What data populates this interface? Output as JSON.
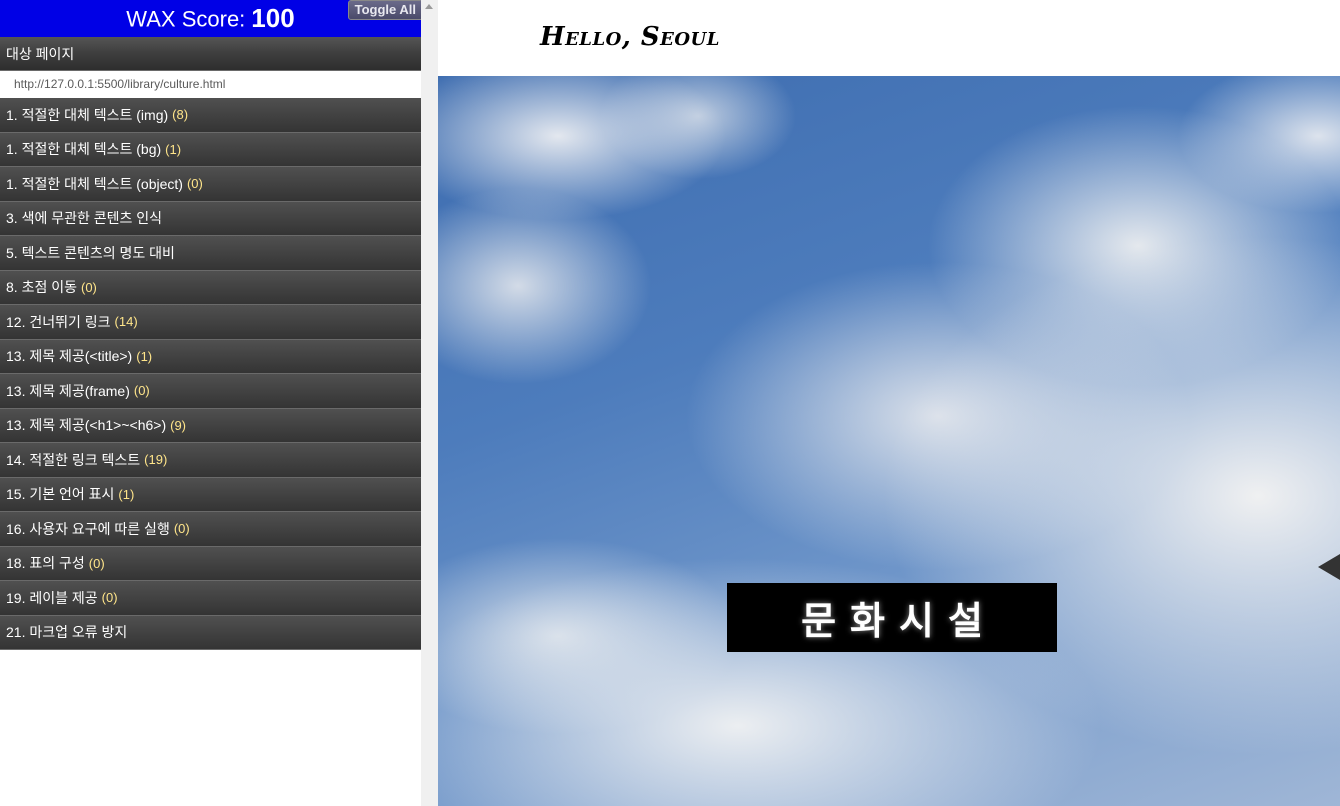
{
  "wax_panel": {
    "score_label": "WAX Score:",
    "score_value": "100",
    "toggle_all_label": "Toggle All",
    "target_page_label": "대상 페이지",
    "target_url": "http://127.0.0.1:5500/library/culture.html",
    "items": [
      {
        "label": "1. 적절한 대체 텍스트 (img)",
        "count": "(8)"
      },
      {
        "label": "1. 적절한 대체 텍스트 (bg)",
        "count": "(1)"
      },
      {
        "label": "1. 적절한 대체 텍스트 (object)",
        "count": "(0)"
      },
      {
        "label": "3. 색에 무관한 콘텐츠 인식",
        "count": ""
      },
      {
        "label": "5. 텍스트 콘텐츠의 명도 대비",
        "count": ""
      },
      {
        "label": "8. 초점 이동",
        "count": "(0)"
      },
      {
        "label": "12. 건너뛰기 링크",
        "count": "(14)"
      },
      {
        "label": "13. 제목 제공(<title>)",
        "count": "(1)"
      },
      {
        "label": "13. 제목 제공(frame)",
        "count": "(0)"
      },
      {
        "label": "13. 제목 제공(<h1>~<h6>)",
        "count": "(9)"
      },
      {
        "label": "14. 적절한 링크 텍스트",
        "count": "(19)"
      },
      {
        "label": "15. 기본 언어 표시",
        "count": "(1)"
      },
      {
        "label": "16. 사용자 요구에 따른 실행",
        "count": "(0)"
      },
      {
        "label": "18. 표의 구성",
        "count": "(0)"
      },
      {
        "label": "19. 레이블 제공",
        "count": "(0)"
      },
      {
        "label": "21. 마크업 오류 방지",
        "count": ""
      }
    ]
  },
  "page": {
    "logo_text": "Hello, Seoul",
    "hero_title": "문화시설"
  },
  "colors": {
    "header_blue": "#0000e6",
    "count_yellow": "#ffe58a",
    "item_bg": "#424242",
    "title_box": "#000000"
  },
  "icons": {
    "divider_scroll_up": "scroll-up-arrow-icon",
    "hero_side_arrow": "slide-next-arrow-icon"
  }
}
